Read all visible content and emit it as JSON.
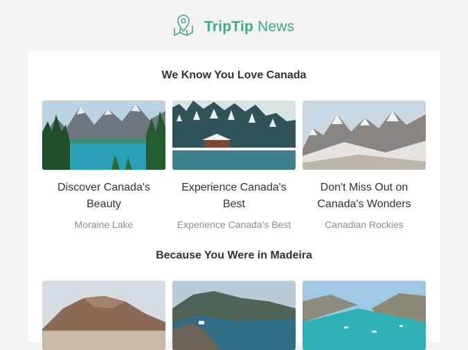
{
  "brand": {
    "name_bold": "TripTip",
    "name_light": "News",
    "icon": "map-pin-icon",
    "accent": "#3fa884"
  },
  "sections": [
    {
      "title": "We Know You Love Canada",
      "items": [
        {
          "title": "Discover Canada's Beauty",
          "subtitle": "Moraine Lake",
          "image": "lake-mountain-forest"
        },
        {
          "title": "Experience Canada's Best",
          "subtitle": "Experience Canada's Best",
          "image": "snowy-cabin-lake"
        },
        {
          "title": "Don't Miss Out on Canada's Wonders",
          "subtitle": "Canadian Rockies",
          "image": "snowy-mountain-range"
        }
      ]
    },
    {
      "title": "Because You Were in Madeira",
      "items": [
        {
          "image": "desert-mountain"
        },
        {
          "image": "coastal-road-ocean"
        },
        {
          "image": "turquoise-bay-boats"
        }
      ]
    }
  ]
}
